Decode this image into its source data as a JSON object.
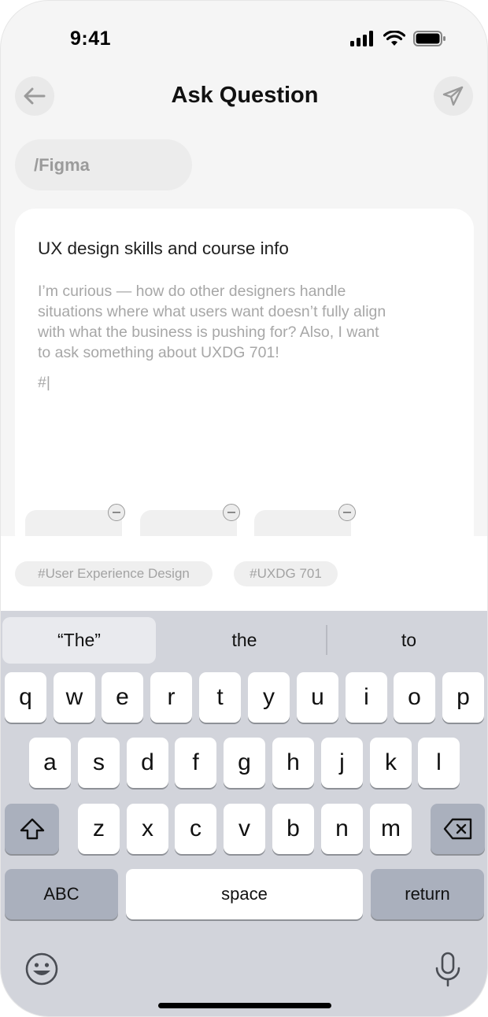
{
  "status_bar": {
    "time": "9:41",
    "icons": [
      "cellular-signal-icon",
      "wifi-icon",
      "battery-icon"
    ]
  },
  "header": {
    "title": "Ask Question",
    "back_icon": "arrow-left-icon",
    "send_icon": "paper-plane-icon"
  },
  "community": {
    "label": "/Figma"
  },
  "question": {
    "title": "UX design skills and course info",
    "body_lines": [
      "I’m curious — how do other designers handle",
      "situations where what users want doesn’t fully align",
      "with what the business is pushing for? Also, I want",
      "to ask something about UXDG 701!"
    ],
    "hashtag_input": "#|"
  },
  "attachments": {
    "count": 3,
    "remove_icon": "minus-circle-icon"
  },
  "tags": [
    "#User Experience Design",
    "#UXDG 701"
  ],
  "keyboard": {
    "suggestions": [
      "“The”",
      "the",
      "to"
    ],
    "row1": [
      "q",
      "w",
      "e",
      "r",
      "t",
      "y",
      "u",
      "i",
      "o",
      "p"
    ],
    "row2": [
      "a",
      "s",
      "d",
      "f",
      "g",
      "h",
      "j",
      "k",
      "l"
    ],
    "row3": [
      "z",
      "x",
      "c",
      "v",
      "b",
      "n",
      "m"
    ],
    "abc_label": "ABC",
    "space_label": "space",
    "return_label": "return",
    "shift_icon": "shift-icon",
    "delete_icon": "delete-icon",
    "emoji_icon": "emoji-icon",
    "mic_icon": "microphone-icon"
  },
  "colors": {
    "background": "#f5f5f5",
    "card": "#ffffff",
    "muted_text": "#a7a7a7",
    "keyboard_bg": "#d2d4db",
    "key_dark": "#aab0bd"
  }
}
